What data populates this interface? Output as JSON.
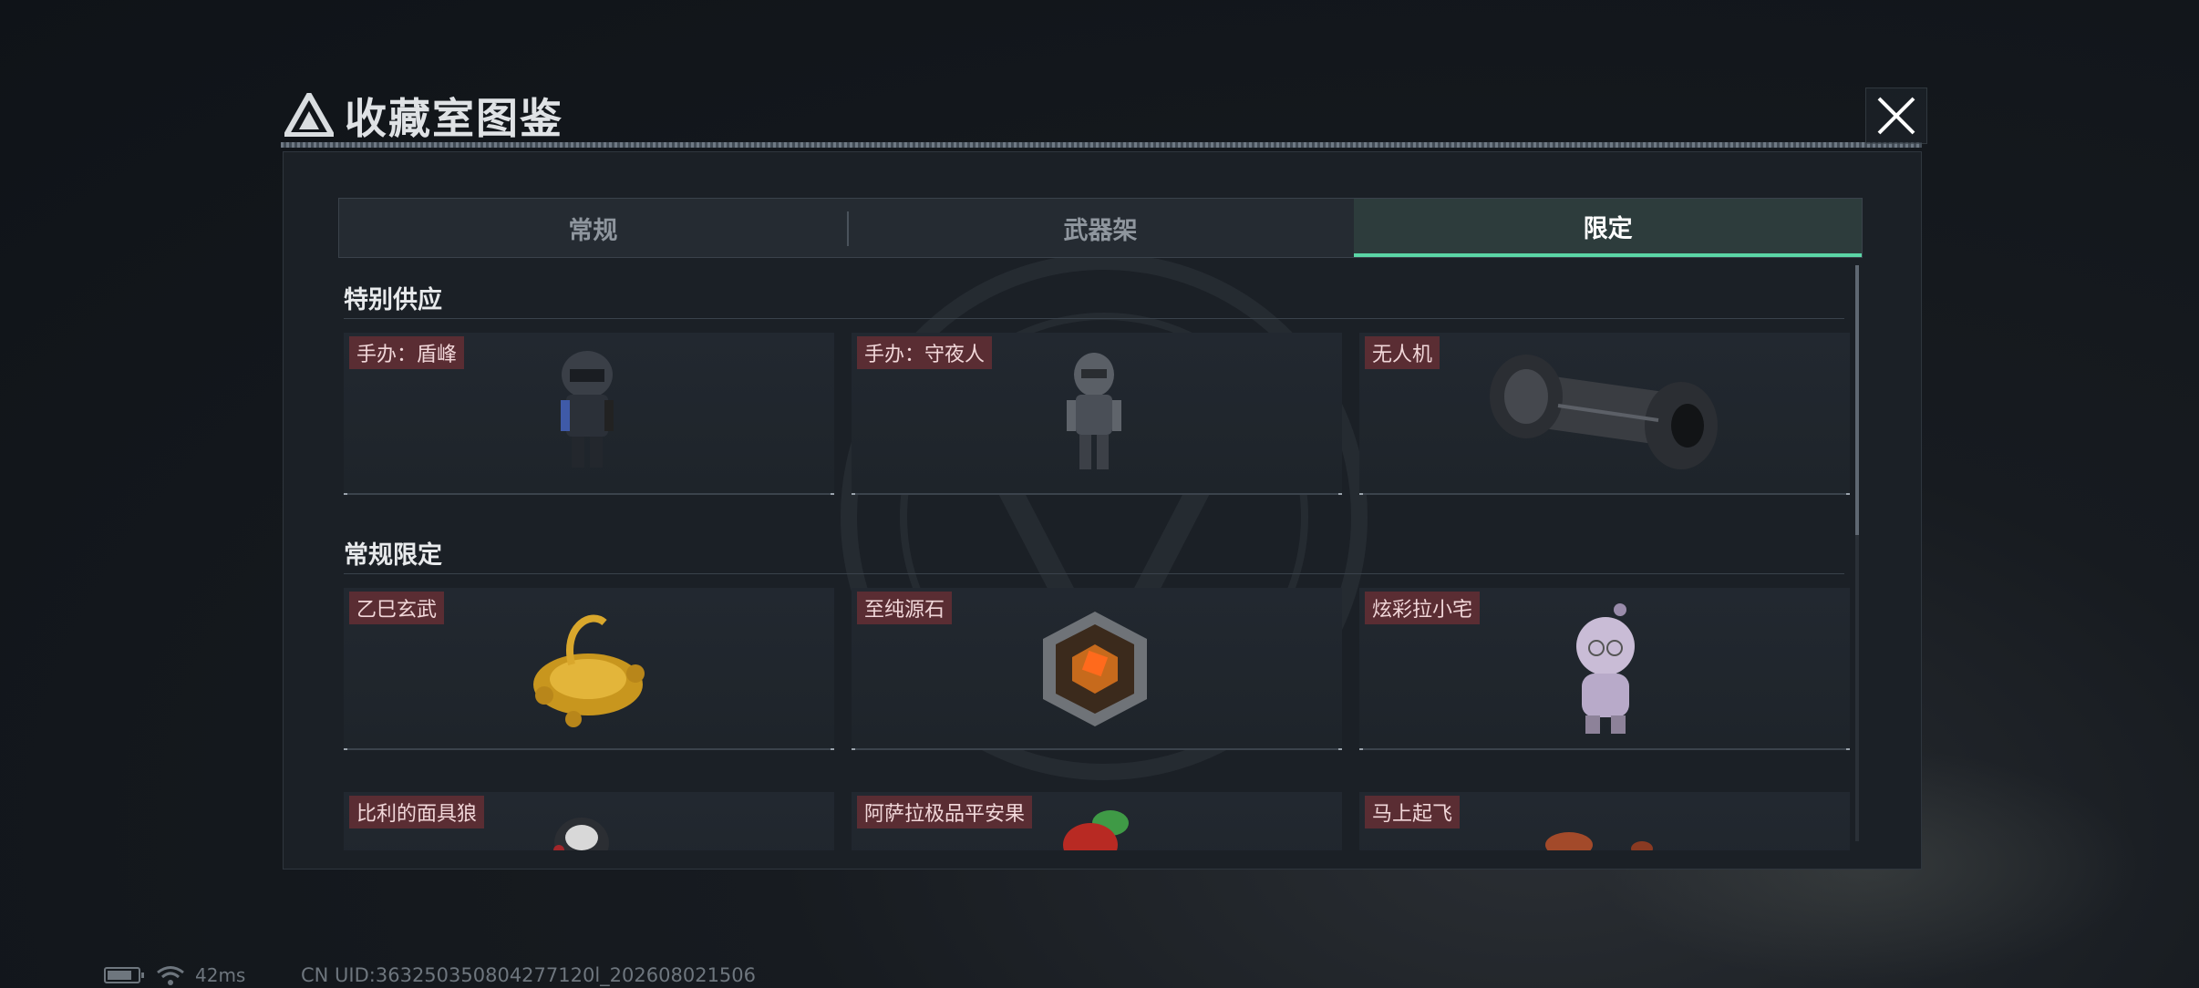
{
  "title": "收藏室图鉴",
  "tabs": [
    {
      "label": "常规",
      "active": false
    },
    {
      "label": "武器架",
      "active": false
    },
    {
      "label": "限定",
      "active": true
    }
  ],
  "sections": [
    {
      "title": "特别供应",
      "items": [
        {
          "label": "手办：盾峰",
          "icon": "armored-soldier-figure-icon"
        },
        {
          "label": "手办：守夜人",
          "icon": "night-watch-figure-icon"
        },
        {
          "label": "无人机",
          "icon": "drone-cylinder-icon"
        }
      ]
    },
    {
      "title": "常规限定",
      "items": [
        {
          "label": "乙巳玄武",
          "icon": "golden-tortoise-snake-icon"
        },
        {
          "label": "至纯源石",
          "icon": "pure-source-stone-icon"
        },
        {
          "label": "炫彩拉小宅",
          "icon": "hooded-doll-icon"
        }
      ]
    },
    {
      "title": "",
      "items": [
        {
          "label": "比利的面具狼",
          "icon": "mask-wolf-icon"
        },
        {
          "label": "阿萨拉极品平安果",
          "icon": "peace-apple-icon"
        },
        {
          "label": "马上起飞",
          "icon": "horse-icon"
        }
      ]
    }
  ],
  "status": {
    "ping": "42ms",
    "uid": "CN UID:363250350804277120l_202608021506"
  },
  "colors": {
    "accent": "#5bd6a6",
    "label_bg": "#5a2d33",
    "panel_bg": "#1b2026"
  }
}
